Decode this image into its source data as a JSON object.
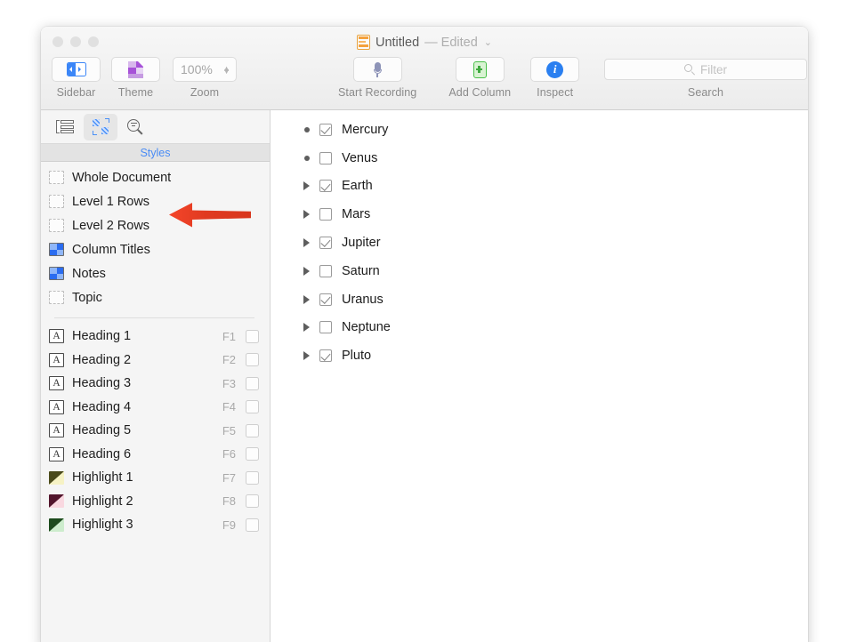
{
  "window": {
    "title_name": "Untitled",
    "title_edited": "— Edited",
    "title_chevron": "⌄",
    "doc_icon": "document-icon"
  },
  "toolbar": {
    "sidebar": {
      "label": "Sidebar",
      "icon": "sidebar-icon"
    },
    "theme": {
      "label": "Theme",
      "icon": "theme-icon"
    },
    "zoom": {
      "value": "100%",
      "label": "Zoom",
      "icon": "stepper-icon"
    },
    "record": {
      "label": "Start Recording",
      "icon": "microphone-icon"
    },
    "add_column": {
      "label": "Add Column",
      "icon": "add-column-icon"
    },
    "inspect": {
      "label": "Inspect",
      "icon": "info-icon",
      "glyph": "i"
    },
    "search": {
      "label": "Search",
      "placeholder": "Filter",
      "icon": "search-icon"
    }
  },
  "sidebar": {
    "tabs": [
      {
        "name": "outline-tab",
        "icon": "outline-icon",
        "active": false
      },
      {
        "name": "styles-tab",
        "icon": "styles-icon",
        "active": true
      },
      {
        "name": "find-tab",
        "icon": "filter-magnifier-icon",
        "active": false
      }
    ],
    "section_header": "Styles",
    "styles": [
      {
        "label": "Whole Document",
        "icon": "dashed-square-icon"
      },
      {
        "label": "Level 1 Rows",
        "icon": "dashed-square-icon"
      },
      {
        "label": "Level 2 Rows",
        "icon": "dashed-square-icon"
      },
      {
        "label": "Column Titles",
        "icon": "checker-square-icon"
      },
      {
        "label": "Notes",
        "icon": "checker-square-icon"
      },
      {
        "label": "Topic",
        "icon": "dashed-square-icon"
      }
    ],
    "named_styles": [
      {
        "label": "Heading 1",
        "key": "F1",
        "icon": "letter-a-icon"
      },
      {
        "label": "Heading 2",
        "key": "F2",
        "icon": "letter-a-icon"
      },
      {
        "label": "Heading 3",
        "key": "F3",
        "icon": "letter-a-icon"
      },
      {
        "label": "Heading 4",
        "key": "F4",
        "icon": "letter-a-icon"
      },
      {
        "label": "Heading 5",
        "key": "F5",
        "icon": "letter-a-icon"
      },
      {
        "label": "Heading 6",
        "key": "F6",
        "icon": "letter-a-icon"
      },
      {
        "label": "Highlight 1",
        "key": "F7",
        "icon": "highlight-swatch-icon",
        "swatch_dark": "#4a4a1b",
        "swatch_light": "#f6f2c4"
      },
      {
        "label": "Highlight 2",
        "key": "F8",
        "icon": "highlight-swatch-icon",
        "swatch_dark": "#52152c",
        "swatch_light": "#f9d8e0"
      },
      {
        "label": "Highlight 3",
        "key": "F9",
        "icon": "highlight-swatch-icon",
        "swatch_dark": "#1d4a1d",
        "swatch_light": "#cdeccd"
      }
    ],
    "letter_a": "A"
  },
  "outline": {
    "rows": [
      {
        "label": "Mercury",
        "checked": true,
        "has_children": false
      },
      {
        "label": "Venus",
        "checked": false,
        "has_children": false
      },
      {
        "label": "Earth",
        "checked": true,
        "has_children": true
      },
      {
        "label": "Mars",
        "checked": false,
        "has_children": true
      },
      {
        "label": "Jupiter",
        "checked": true,
        "has_children": true
      },
      {
        "label": "Saturn",
        "checked": false,
        "has_children": true
      },
      {
        "label": "Uranus",
        "checked": true,
        "has_children": true
      },
      {
        "label": "Neptune",
        "checked": false,
        "has_children": true
      },
      {
        "label": "Pluto",
        "checked": true,
        "has_children": true
      }
    ]
  },
  "annotation": {
    "arrow": "red-left-arrow",
    "color": "#e23b22"
  }
}
